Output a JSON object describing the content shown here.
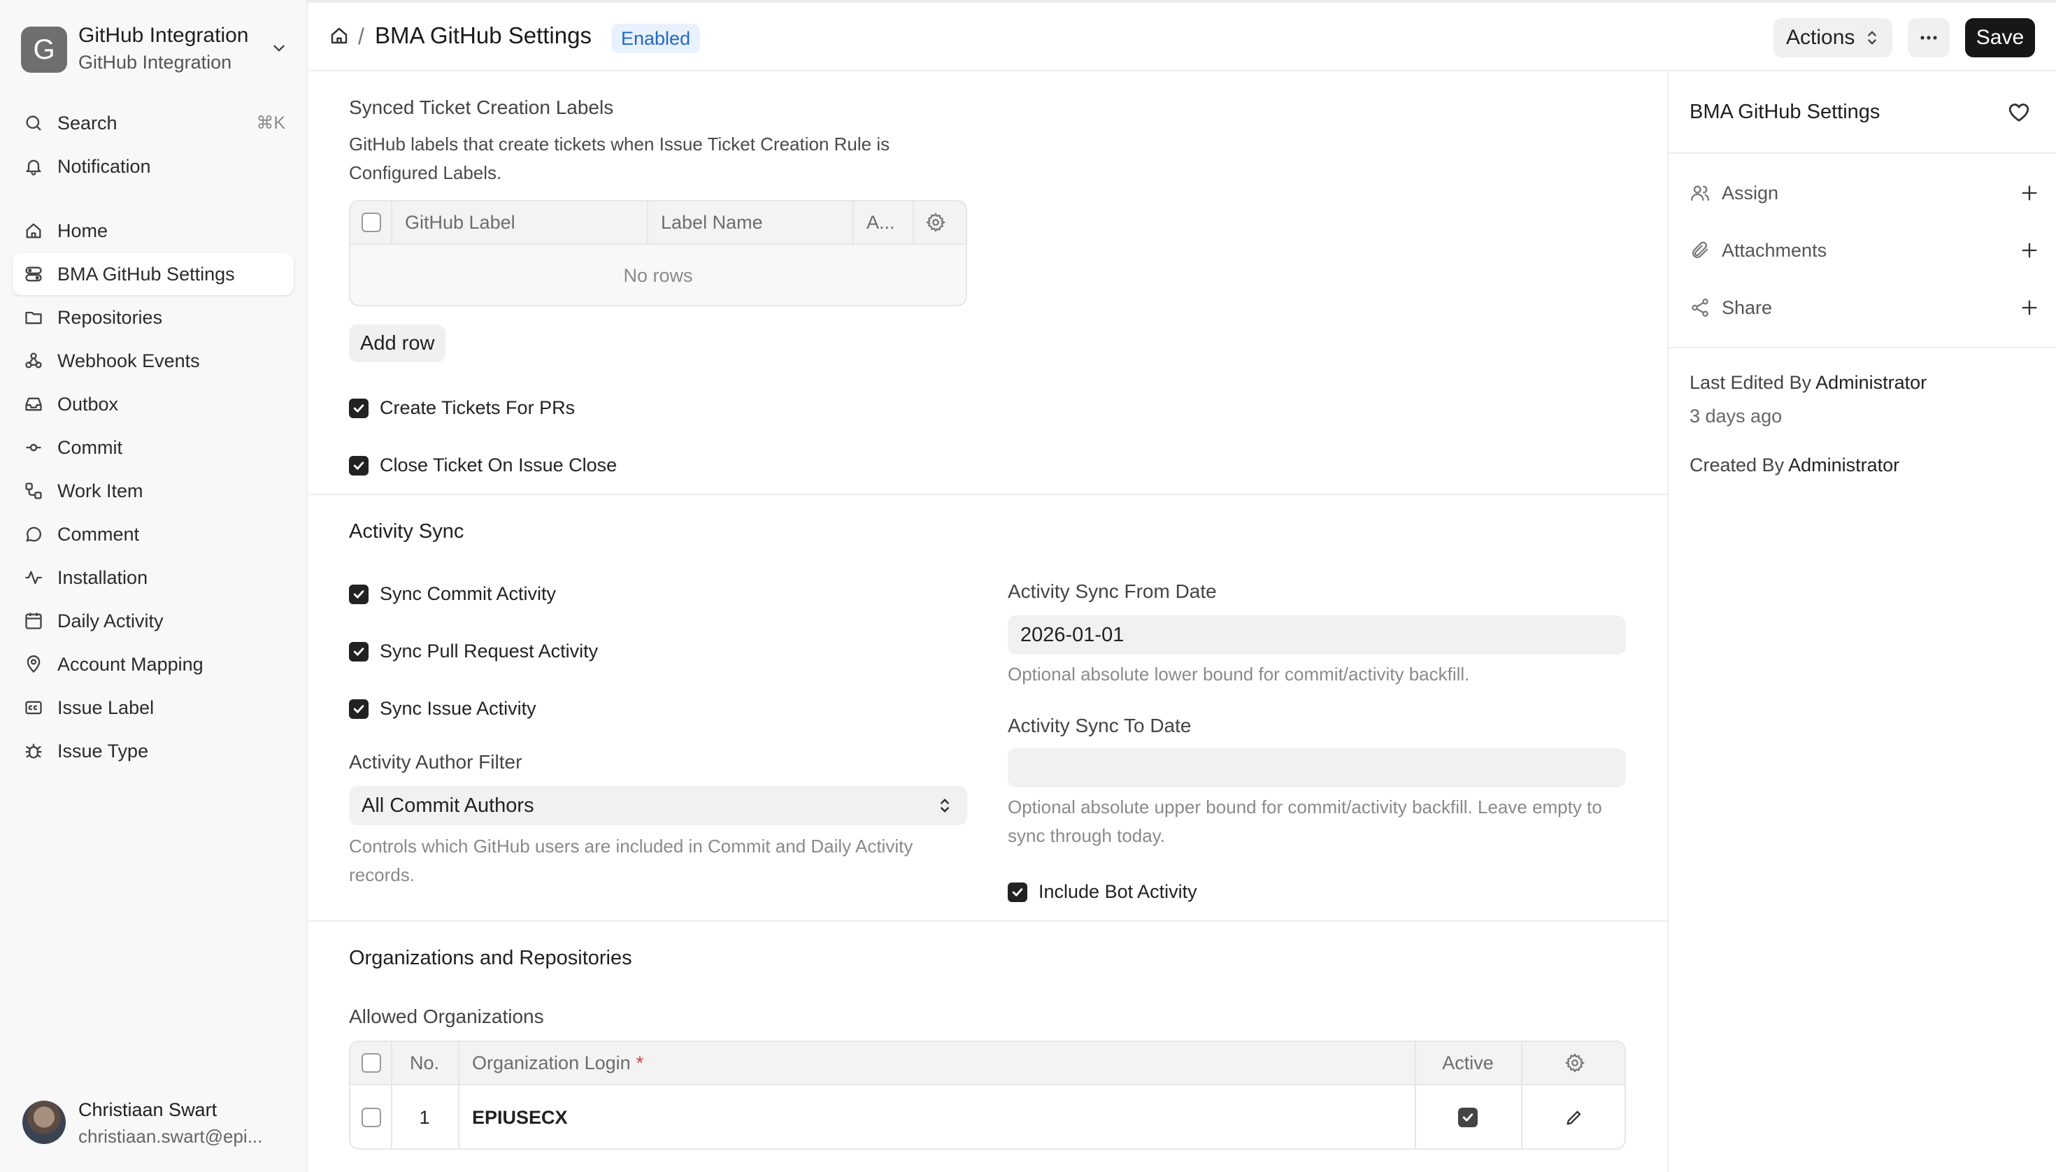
{
  "app": {
    "logo_letter": "G",
    "title": "GitHub Integration",
    "subtitle": "GitHub Integration"
  },
  "sidebar": {
    "search_label": "Search",
    "search_shortcut": "⌘K",
    "notification_label": "Notification",
    "items": [
      {
        "label": "Home",
        "icon": "home-icon"
      },
      {
        "label": "BMA GitHub Settings",
        "icon": "settings-stack-icon",
        "active": true
      },
      {
        "label": "Repositories",
        "icon": "folder-icon"
      },
      {
        "label": "Webhook Events",
        "icon": "webhook-icon"
      },
      {
        "label": "Outbox",
        "icon": "inbox-icon"
      },
      {
        "label": "Commit",
        "icon": "commit-icon"
      },
      {
        "label": "Work Item",
        "icon": "workflow-icon"
      },
      {
        "label": "Comment",
        "icon": "comment-icon"
      },
      {
        "label": "Installation",
        "icon": "activity-icon"
      },
      {
        "label": "Daily Activity",
        "icon": "calendar-icon"
      },
      {
        "label": "Account Mapping",
        "icon": "map-pin-icon"
      },
      {
        "label": "Issue Label",
        "icon": "label-icon"
      },
      {
        "label": "Issue Type",
        "icon": "bug-icon"
      }
    ],
    "user": {
      "name": "Christiaan Swart",
      "email": "christiaan.swart@epi..."
    }
  },
  "header": {
    "breadcrumb_sep": "/",
    "title": "BMA GitHub Settings",
    "status": "Enabled",
    "actions_label": "Actions",
    "save_label": "Save"
  },
  "main": {
    "synced_labels": {
      "label": "Synced Ticket Creation Labels",
      "description": "GitHub labels that create tickets when Issue Ticket Creation Rule is Configured Labels.",
      "columns": [
        "GitHub Label",
        "Label Name",
        "A..."
      ],
      "empty_text": "No rows",
      "add_row_label": "Add row"
    },
    "create_tickets_for_prs": {
      "label": "Create Tickets For PRs",
      "checked": true
    },
    "close_ticket_on_issue_close": {
      "label": "Close Ticket On Issue Close",
      "checked": true
    },
    "activity_sync": {
      "title": "Activity Sync",
      "sync_commit": {
        "label": "Sync Commit Activity",
        "checked": true
      },
      "sync_pr": {
        "label": "Sync Pull Request Activity",
        "checked": true
      },
      "sync_issue": {
        "label": "Sync Issue Activity",
        "checked": true
      },
      "author_filter": {
        "label": "Activity Author Filter",
        "value": "All Commit Authors",
        "description": "Controls which GitHub users are included in Commit and Daily Activity records."
      },
      "from_date": {
        "label": "Activity Sync From Date",
        "value": "2026-01-01",
        "description": "Optional absolute lower bound for commit/activity backfill."
      },
      "to_date": {
        "label": "Activity Sync To Date",
        "value": "",
        "description": "Optional absolute upper bound for commit/activity backfill. Leave empty to sync through today."
      },
      "include_bot": {
        "label": "Include Bot Activity",
        "checked": true
      }
    },
    "orgs": {
      "title": "Organizations and Repositories",
      "allowed_label": "Allowed Organizations",
      "columns": {
        "no": "No.",
        "login": "Organization Login",
        "required_mark": "*",
        "active": "Active"
      },
      "rows": [
        {
          "no": "1",
          "login": "EPIUSECX",
          "active": true
        }
      ]
    }
  },
  "right_panel": {
    "title": "BMA GitHub Settings",
    "assign_label": "Assign",
    "attachments_label": "Attachments",
    "share_label": "Share",
    "last_edited_prefix": "Last Edited By",
    "last_edited_by": "Administrator",
    "last_edited_time": "3 days ago",
    "created_prefix": "Created By",
    "created_by": "Administrator"
  }
}
